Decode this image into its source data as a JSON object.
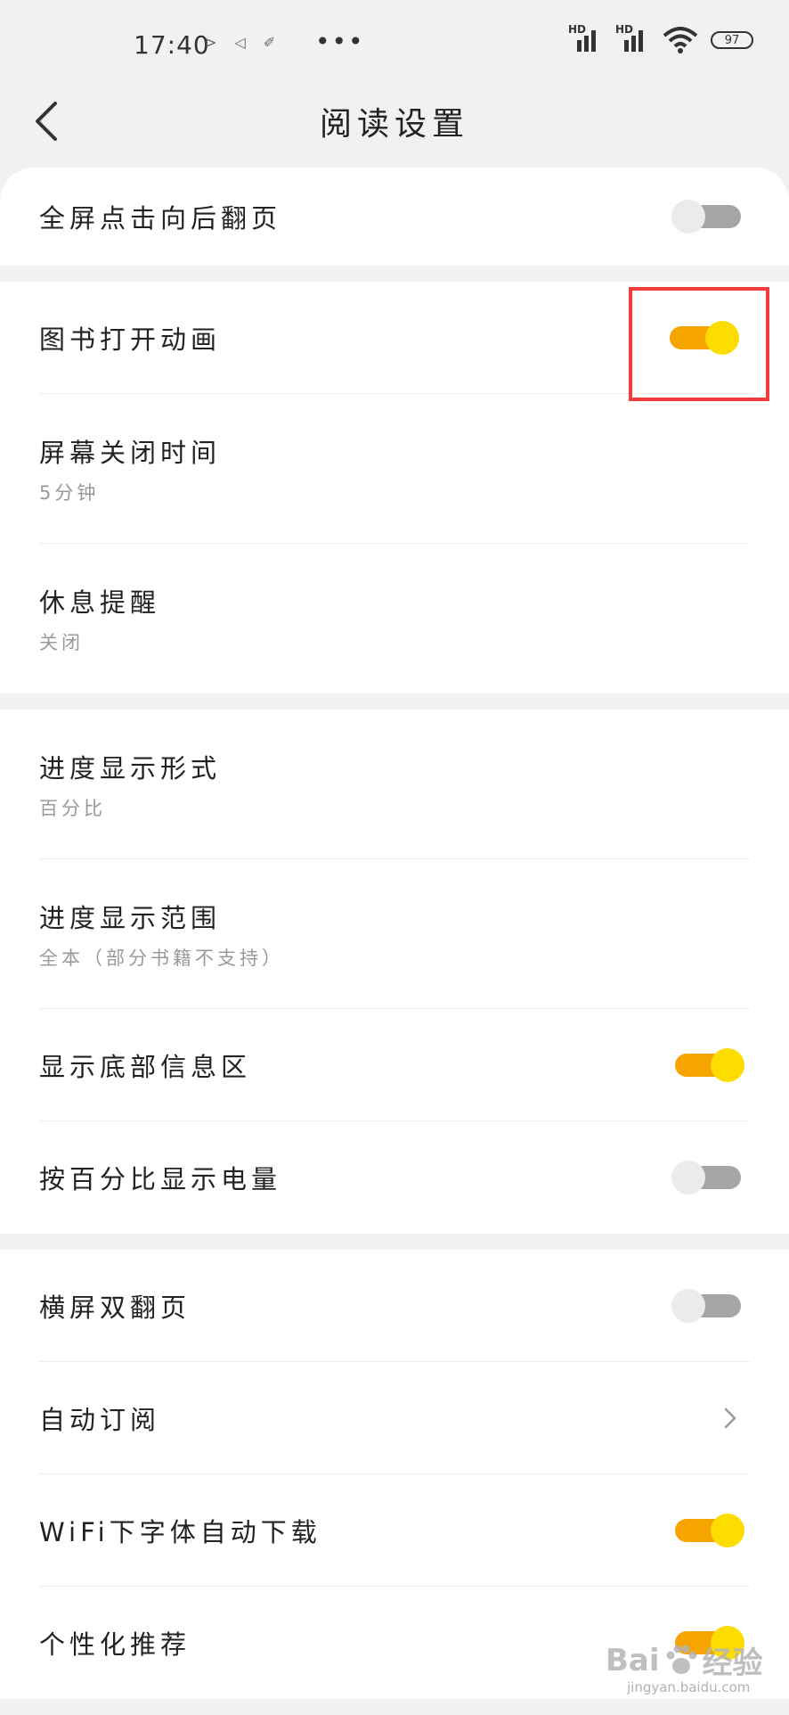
{
  "status_bar": {
    "time": "17:40",
    "network_label": "HD",
    "battery": "97"
  },
  "header": {
    "title": "阅读设置"
  },
  "settings": {
    "fullscreen_tap": {
      "label": "全屏点击向后翻页",
      "on": false
    },
    "book_open_animation": {
      "label": "图书打开动画",
      "on": true
    },
    "screen_off_time": {
      "label": "屏幕关闭时间",
      "value": "5分钟"
    },
    "rest_reminder": {
      "label": "休息提醒",
      "value": "关闭"
    },
    "progress_format": {
      "label": "进度显示形式",
      "value": "百分比"
    },
    "progress_range": {
      "label": "进度显示范围",
      "value": "全本（部分书籍不支持）"
    },
    "bottom_info": {
      "label": "显示底部信息区",
      "on": true
    },
    "battery_percent": {
      "label": "按百分比显示电量",
      "on": false
    },
    "landscape_double": {
      "label": "横屏双翻页",
      "on": false
    },
    "auto_subscribe": {
      "label": "自动订阅"
    },
    "wifi_font_download": {
      "label": "WiFi下字体自动下载",
      "on": true
    },
    "personalized": {
      "label": "个性化推荐",
      "on": true
    }
  },
  "watermark": {
    "text_left": "Bai",
    "text_right": "经验",
    "sub": "jingyan.baidu.com"
  },
  "colors": {
    "toggle_on_track": "#f6a400",
    "toggle_on_knob": "#fddc00",
    "toggle_off_track": "#a5a5a5",
    "highlight": "#f03c3c"
  }
}
